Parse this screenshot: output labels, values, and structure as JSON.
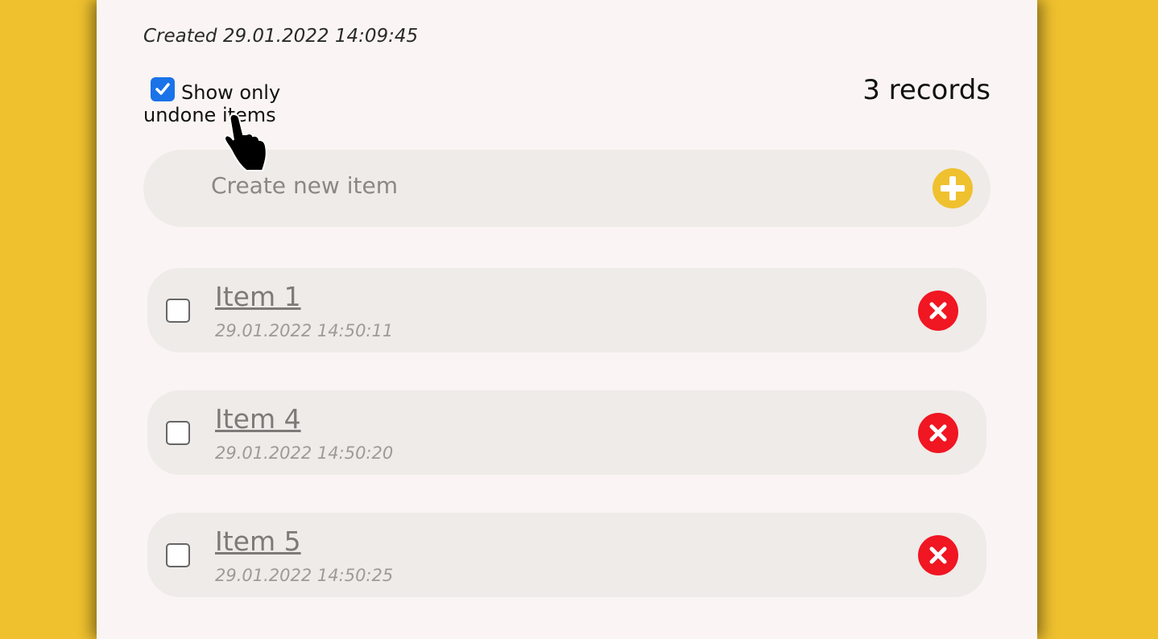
{
  "header": {
    "created_label": "Created 29.01.2022 14:09:45",
    "filter_line1": "Show only",
    "filter_line2": "undone items",
    "filter_checked": true,
    "records_count": "3 records"
  },
  "create": {
    "placeholder": "Create new item",
    "add_icon": "plus-circle-icon"
  },
  "items": [
    {
      "title": "Item 1",
      "date": "29.01.2022 14:50:11",
      "done": false
    },
    {
      "title": "Item 4",
      "date": "29.01.2022 14:50:20",
      "done": false
    },
    {
      "title": "Item 5",
      "date": "29.01.2022 14:50:25",
      "done": false
    }
  ],
  "colors": {
    "background": "#efc12f",
    "panel": "#faf5f4",
    "row": "#efebe8",
    "delete": "#f01622",
    "checkbox_checked": "#1a73e8"
  }
}
